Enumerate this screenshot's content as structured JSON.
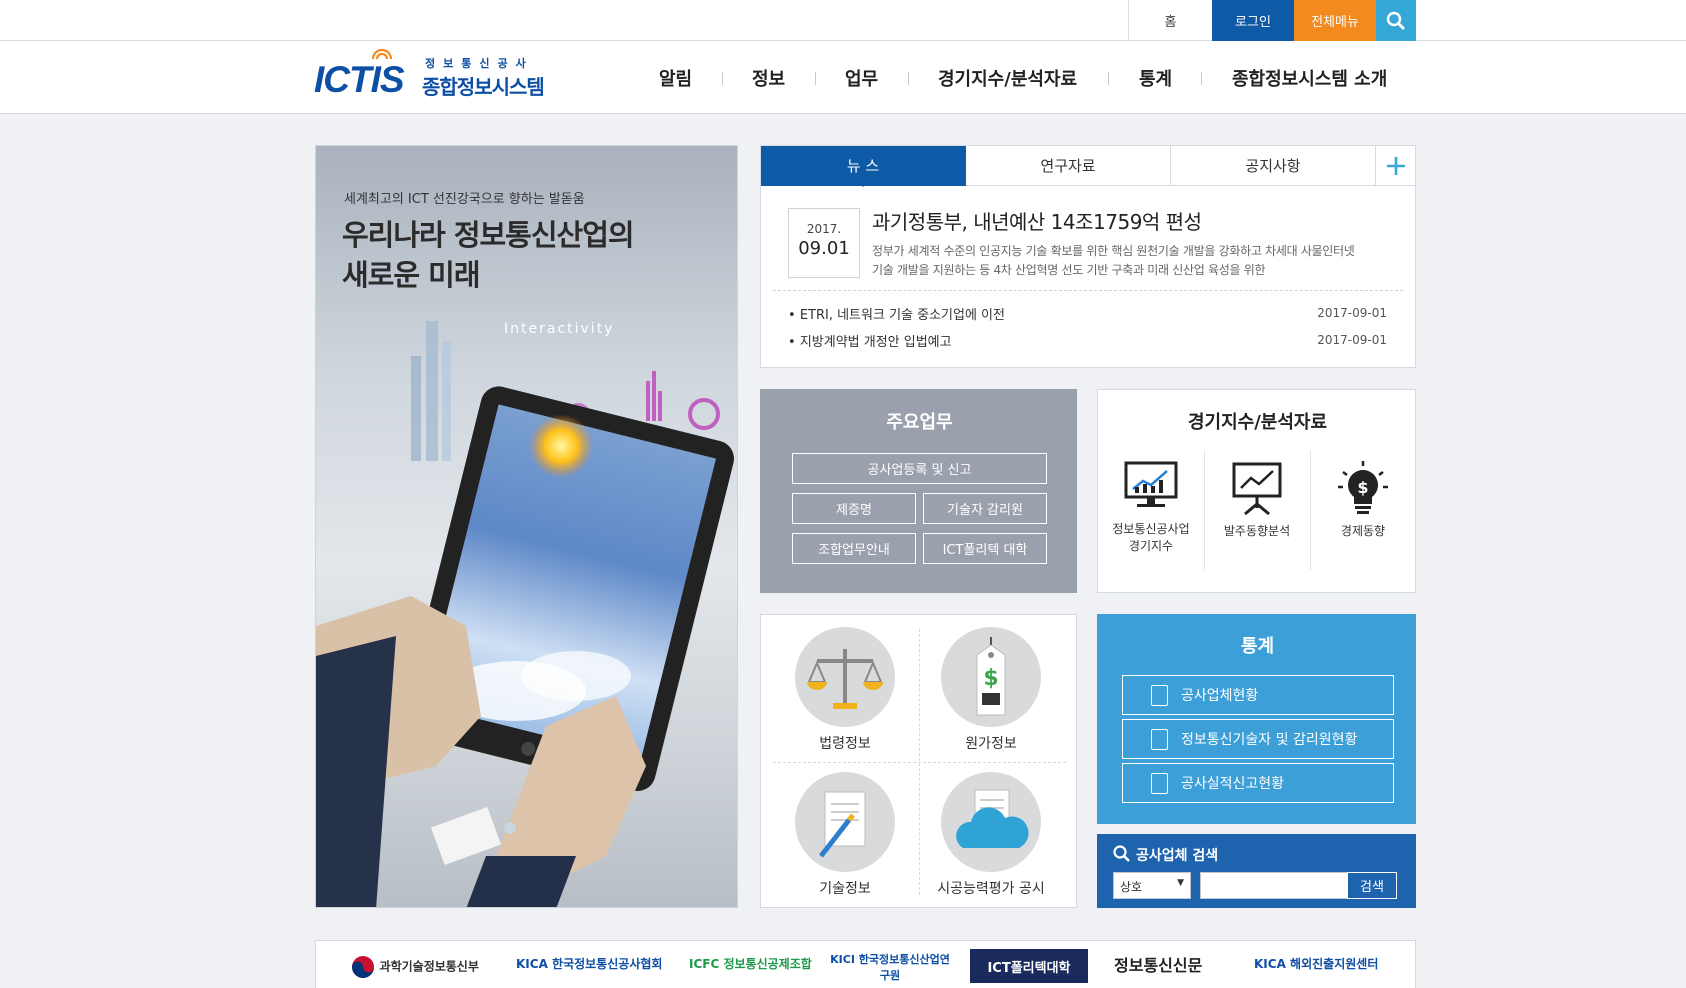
{
  "topbar": {
    "home": "홈",
    "login": "로그인",
    "allmenu": "전체메뉴"
  },
  "logo": {
    "main": "ICTIS",
    "sub1": "정보통신공사",
    "sub2": "종합정보시스템"
  },
  "gnb": [
    "알림",
    "정보",
    "업무",
    "경기지수/분석자료",
    "통계",
    "종합정보시스템 소개"
  ],
  "hero": {
    "subtitle": "세계최고의 ICT 선진강국으로 향하는 발돋움",
    "title1": "우리나라 정보통신산업의",
    "title2": "새로운 미래",
    "image_text": "Interactivity"
  },
  "news": {
    "tabs": [
      "뉴 스",
      "연구자료",
      "공지사항"
    ],
    "featured": {
      "year": "2017.",
      "day": "09.01",
      "title": "과기정통부, 내년예산 14조1759억 편성",
      "body1": "정부가 세계적 수준의 인공지능 기술 확보를 위한 핵심 원천기술 개발을 강화하고 차세대 사물인터넷",
      "body2": "기술 개발을 지원하는 등 4차 산업혁명 선도 기반 구축과 미래 신산업 육성을 위한"
    },
    "items": [
      {
        "title": "ETRI, 네트워크 기술 중소기업에 이전",
        "date": "2017-09-01"
      },
      {
        "title": "지방계약법 개정안 입법예고",
        "date": "2017-09-01"
      }
    ]
  },
  "main_work": {
    "title": "주요업무",
    "buttons": [
      "공사업등록 및 신고",
      "제증명",
      "기술자 감리원",
      "조합업무안내",
      "ICT폴리텍 대학"
    ]
  },
  "econ": {
    "title": "경기지수/분석자료",
    "items": [
      {
        "l1": "정보통신공사업",
        "l2": "경기지수"
      },
      {
        "l1": "발주동향분석",
        "l2": ""
      },
      {
        "l1": "경제동향",
        "l2": ""
      }
    ]
  },
  "info": {
    "items": [
      "법령정보",
      "원가정보",
      "기술정보",
      "시공능력평가 공시"
    ]
  },
  "stats": {
    "title": "통계",
    "buttons": [
      "공사업체현황",
      "정보통신기술자 및 감리원현황",
      "공사실적신고현황"
    ]
  },
  "search": {
    "title": "공사업체 검색",
    "select": "상호",
    "button": "검색"
  },
  "footer_logos": [
    "과학기술정보통신부",
    "KICA 한국정보통신공사협회",
    "ICFC 정보통신공제조합",
    "KICI 한국정보통신산업연구원",
    "ICT폴리텍대학",
    "정보통신신문",
    "KICA 해외진출지원센터"
  ],
  "colors": {
    "blue": "#0e5aa7",
    "orange": "#f28a1f",
    "cyan": "#35a8d8",
    "gray_panel": "#9aa1ad",
    "stat_blue": "#3d9fd8",
    "search_blue": "#1e63ad"
  }
}
